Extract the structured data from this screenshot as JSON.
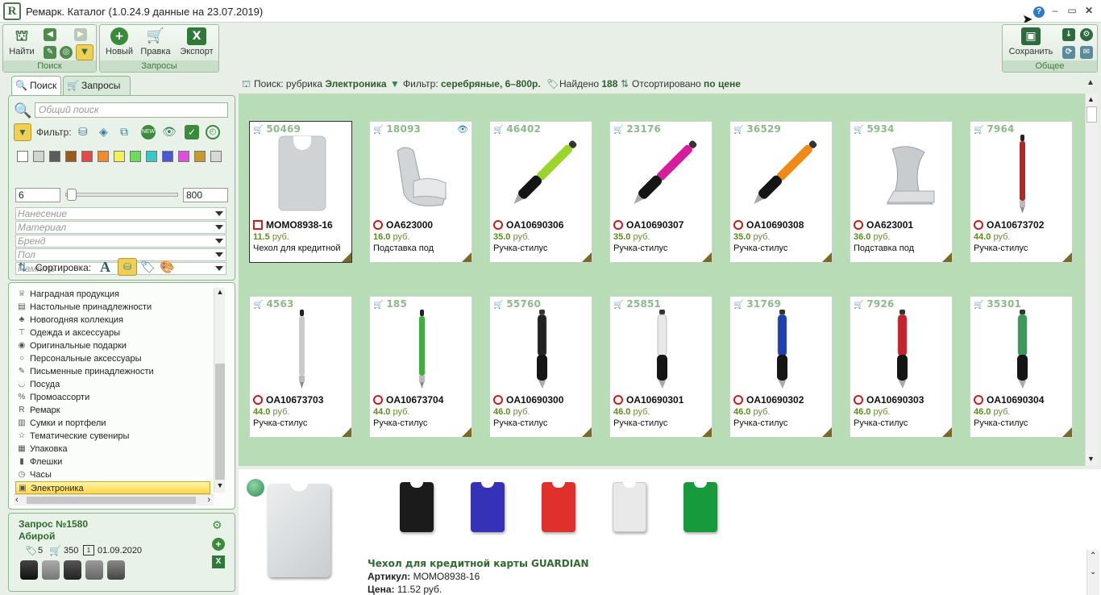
{
  "window": {
    "title": "Ремарк. Каталог (1.0.24.9 данные на 23.07.2019)",
    "logo": "R"
  },
  "ribbon": {
    "search_group": {
      "label": "Поиск",
      "find_label": "Найти"
    },
    "requests_group": {
      "label": "Запросы",
      "new_label": "Новый",
      "edit_label": "Правка",
      "export_label": "Экспорт"
    },
    "general_group": {
      "label": "Общее",
      "save_label": "Сохранить"
    }
  },
  "left": {
    "tabs": [
      {
        "label": "Поиск",
        "active": true
      },
      {
        "label": "Запросы",
        "active": false
      }
    ],
    "search_placeholder": "Общий поиск",
    "filter_label": "Фильтр:",
    "swatch_colors": [
      "#ffffff",
      "#cfd6cf",
      "#5b5b5b",
      "#9a5a1e",
      "#e04a4a",
      "#f08b2c",
      "#f4f05a",
      "#6edb5c",
      "#38c8c8",
      "#4b58d6",
      "#e04fd8",
      "#c89a2e",
      "#d8d8d8"
    ],
    "price_min": "6",
    "price_max": "800",
    "price_slider_fraction": 0,
    "dropdowns": [
      "Нанесение",
      "Материал",
      "Бренд",
      "Пол",
      "Память"
    ],
    "sort_label": "Сортировка:",
    "categories": [
      {
        "label": "Наградная продукция",
        "icon": "trophy-icon"
      },
      {
        "label": "Настольные принадлежности",
        "icon": "desk-icon"
      },
      {
        "label": "Новогодняя коллекция",
        "icon": "tree-icon"
      },
      {
        "label": "Одежда и аксессуары",
        "icon": "shirt-icon"
      },
      {
        "label": "Оригинальные подарки",
        "icon": "bulb-icon"
      },
      {
        "label": "Персональные аксессуары",
        "icon": "ring-icon"
      },
      {
        "label": "Письменные принадлежности",
        "icon": "pen-icon"
      },
      {
        "label": "Посуда",
        "icon": "cup-icon"
      },
      {
        "label": "Промоассорти",
        "icon": "percent-icon"
      },
      {
        "label": "Ремарк",
        "icon": "logo-icon"
      },
      {
        "label": "Сумки и портфели",
        "icon": "bag-icon"
      },
      {
        "label": "Тематические сувениры",
        "icon": "star-icon"
      },
      {
        "label": "Упаковка",
        "icon": "box-icon"
      },
      {
        "label": "Флешки",
        "icon": "flash-icon"
      },
      {
        "label": "Часы",
        "icon": "clock-icon"
      },
      {
        "label": "Электроника",
        "icon": "chip-icon",
        "selected": true
      }
    ],
    "request": {
      "title": "Запрос №1580",
      "client": "Абирой",
      "tags_count": "5",
      "cart_count": "350",
      "date": "01.09.2020"
    }
  },
  "infobar": {
    "search_prefix": "Поиск: рубрика",
    "search_value": "Электроника",
    "filter_prefix": "Фильтр:",
    "filter_value": "серебряные, 6–800р.",
    "found_prefix": "Найдено",
    "found_value": "188",
    "sorted_prefix": "Отсортировано",
    "sorted_value": "по цене"
  },
  "products": [
    {
      "stock": "50469",
      "code": "MOMO8938-16",
      "price": "11.5",
      "currency": "руб.",
      "name": "Чехол для кредитной",
      "kind": "card",
      "color": "#cfd3d6",
      "selected": true,
      "brand": "square"
    },
    {
      "stock": "18093",
      "code": "OA623000",
      "price": "16.0",
      "currency": "руб.",
      "name": "Подставка под",
      "kind": "stand",
      "color": "#d2d5d8",
      "eye": true
    },
    {
      "stock": "46402",
      "code": "OA10690306",
      "price": "35.0",
      "currency": "руб.",
      "name": "Ручка-стилус",
      "kind": "pen-diag",
      "color": "#9ad52a"
    },
    {
      "stock": "23176",
      "code": "OA10690307",
      "price": "35.0",
      "currency": "руб.",
      "name": "Ручка-стилус",
      "kind": "pen-diag",
      "color": "#d61c9c"
    },
    {
      "stock": "36529",
      "code": "OA10690308",
      "price": "35.0",
      "currency": "руб.",
      "name": "Ручка-стилус",
      "kind": "pen-diag",
      "color": "#f08a16"
    },
    {
      "stock": "5934",
      "code": "OA623001",
      "price": "36.0",
      "currency": "руб.",
      "name": "Подставка под",
      "kind": "stand2",
      "color": "#c9ccce"
    },
    {
      "stock": "7964",
      "code": "OA10673702",
      "price": "44.0",
      "currency": "руб.",
      "name": "Ручка-стилус",
      "kind": "pen-thin",
      "color": "#b5262b"
    },
    {
      "stock": "4563",
      "code": "OA10673703",
      "price": "44.0",
      "currency": "руб.",
      "name": "Ручка-стилус",
      "kind": "pen-thin",
      "color": "#c8cacc"
    },
    {
      "stock": "185",
      "code": "OA10673704",
      "price": "44.0",
      "currency": "руб.",
      "name": "Ручка-стилус",
      "kind": "pen-thin",
      "color": "#3fae3a"
    },
    {
      "stock": "55760",
      "code": "OA10690300",
      "price": "46.0",
      "currency": "руб.",
      "name": "Ручка-стилус",
      "kind": "pen-vert",
      "color": "#222222"
    },
    {
      "stock": "25851",
      "code": "OA10690301",
      "price": "46.0",
      "currency": "руб.",
      "name": "Ручка-стилус",
      "kind": "pen-vert",
      "color": "#e8e8e8"
    },
    {
      "stock": "31769",
      "code": "OA10690302",
      "price": "46.0",
      "currency": "руб.",
      "name": "Ручка-стилус",
      "kind": "pen-vert",
      "color": "#1e3fae"
    },
    {
      "stock": "7926",
      "code": "OA10690303",
      "price": "46.0",
      "currency": "руб.",
      "name": "Ручка-стилус",
      "kind": "pen-vert",
      "color": "#c8232a"
    },
    {
      "stock": "35301",
      "code": "OA10690304",
      "price": "46.0",
      "currency": "руб.",
      "name": "Ручка-стилус",
      "kind": "pen-vert",
      "color": "#3a9a5a"
    }
  ],
  "detail": {
    "title": "Чехол для кредитной карты GUARDIAN",
    "article_label": "Артикул:",
    "article_value": "MOMO8938-16",
    "price_label": "Цена:",
    "price_value": "11.52 руб.",
    "variant_colors": [
      "#1b1b1b",
      "#3532b8",
      "#e0302b",
      "#e9e9e9",
      "#169a3c"
    ]
  }
}
